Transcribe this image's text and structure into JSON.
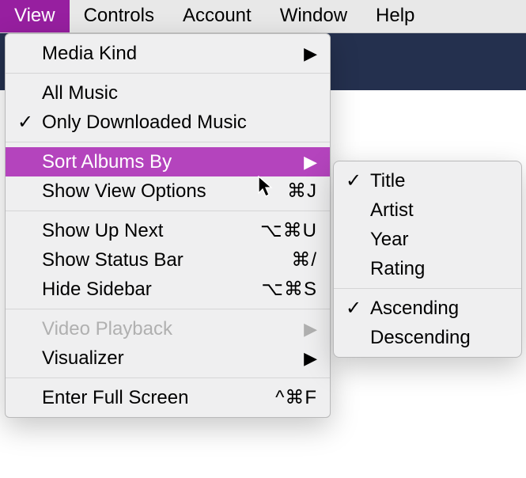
{
  "menubar": {
    "items": [
      "View",
      "Controls",
      "Account",
      "Window",
      "Help"
    ],
    "active_index": 0
  },
  "dropdown": {
    "media_kind": "Media Kind",
    "all_music": "All Music",
    "only_downloaded": "Only Downloaded Music",
    "sort_albums_by": "Sort Albums By",
    "show_view_options": {
      "label": "Show View Options",
      "shortcut": "⌘J"
    },
    "show_up_next": {
      "label": "Show Up Next",
      "shortcut": "⌥⌘U"
    },
    "show_status_bar": {
      "label": "Show Status Bar",
      "shortcut": "⌘/"
    },
    "hide_sidebar": {
      "label": "Hide Sidebar",
      "shortcut": "⌥⌘S"
    },
    "video_playback": "Video Playback",
    "visualizer": "Visualizer",
    "enter_full_screen": {
      "label": "Enter Full Screen",
      "shortcut": "^⌘F"
    }
  },
  "submenu": {
    "title": "Title",
    "artist": "Artist",
    "year": "Year",
    "rating": "Rating",
    "ascending": "Ascending",
    "descending": "Descending"
  }
}
